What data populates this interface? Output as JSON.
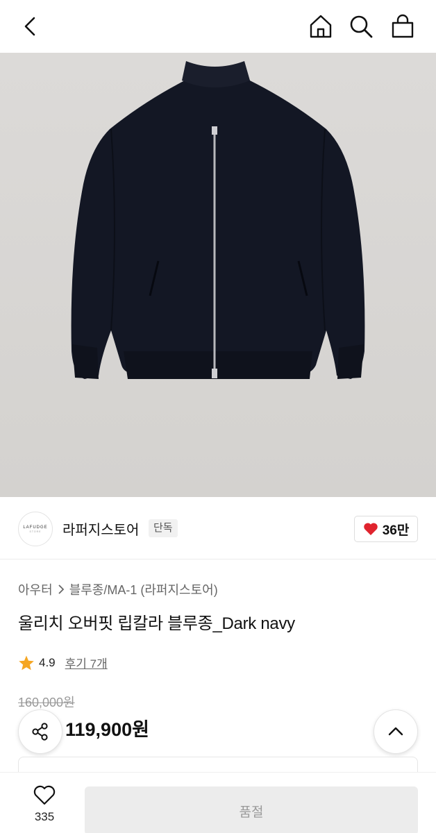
{
  "colors": {
    "accent_red": "#e0242e",
    "star": "#f5a623",
    "hero_bg": "#dad8d6",
    "jacket": "#141826"
  },
  "topbar": {
    "icons": [
      "back-icon",
      "home-icon",
      "search-icon",
      "shopping-bag-icon"
    ]
  },
  "store": {
    "logo_text": "LAFUDGE",
    "logo_sub": "STORE",
    "name": "라퍼지스토어",
    "badge": "단독",
    "likes": "36만"
  },
  "product": {
    "breadcrumb": [
      "아우터",
      "블루종/MA-1 (라퍼지스토어)"
    ],
    "title": "울리치 오버핏 립칼라 블루종_Dark navy",
    "rating": "4.9",
    "reviews": "후기 7개",
    "original_price": "160,000원",
    "price": "119,900원"
  },
  "bottom": {
    "wish_count": "335",
    "cta_label": "품절"
  }
}
